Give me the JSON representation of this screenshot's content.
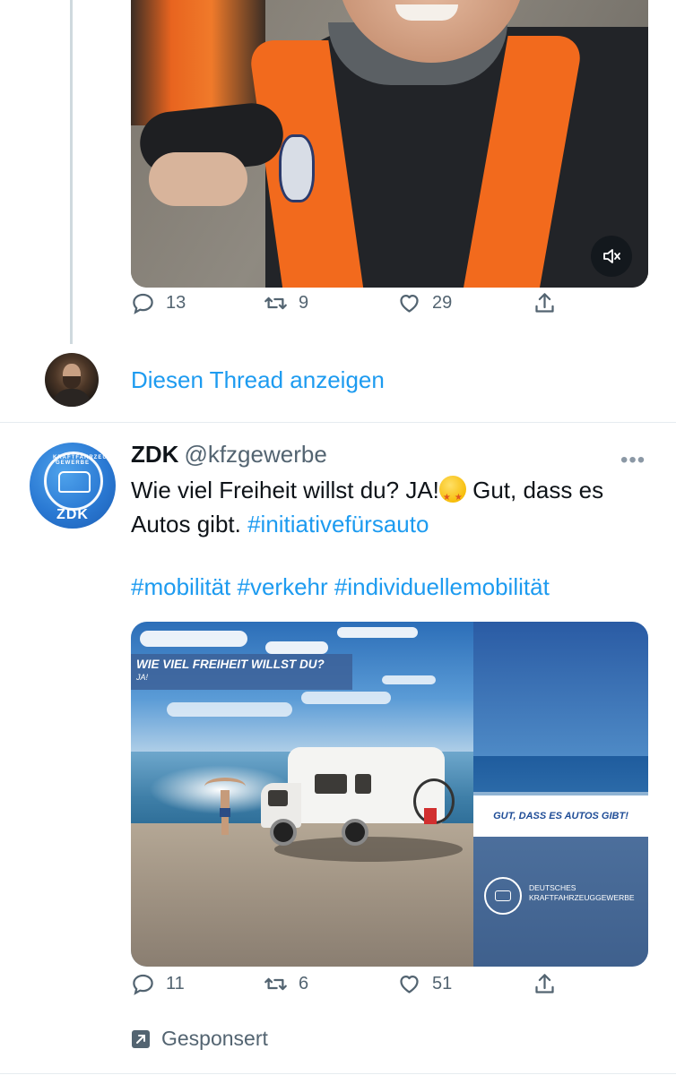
{
  "tweet1": {
    "stats": {
      "replies": "13",
      "retweets": "9",
      "likes": "29"
    },
    "show_thread": "Diesen Thread anzeigen"
  },
  "tweet2": {
    "author_name": "ZDK",
    "author_handle": "@kfzgewerbe",
    "avatar_label": "ZDK",
    "avatar_arc": "KRAFTFAHRZEUG GEWERBE",
    "text_part1": "Wie viel Freiheit willst du? JA!",
    "text_part2": " Gut, dass es Autos gibt. ",
    "hashtag1": "#initiativefürsauto",
    "hashtags_line2": "#mobilität #verkehr #individuellemobilität",
    "ad": {
      "banner_title": "WIE VIEL FREIHEIT WILLST DU?",
      "banner_sub": "JA!",
      "tagline": "GUT, DASS ES AUTOS GIBT!",
      "org_line1": "DEUTSCHES",
      "org_line2": "KRAFTFAHRZEUGGEWERBE"
    },
    "stats": {
      "replies": "11",
      "retweets": "6",
      "likes": "51"
    },
    "sponsored_label": "Gesponsert"
  },
  "icons": [
    "reply-icon",
    "retweet-icon",
    "like-icon",
    "share-icon",
    "mute-icon",
    "more-icon",
    "promoted-icon"
  ],
  "colors": {
    "link": "#1d9bf0",
    "muted": "#536471",
    "text": "#0f1419"
  }
}
